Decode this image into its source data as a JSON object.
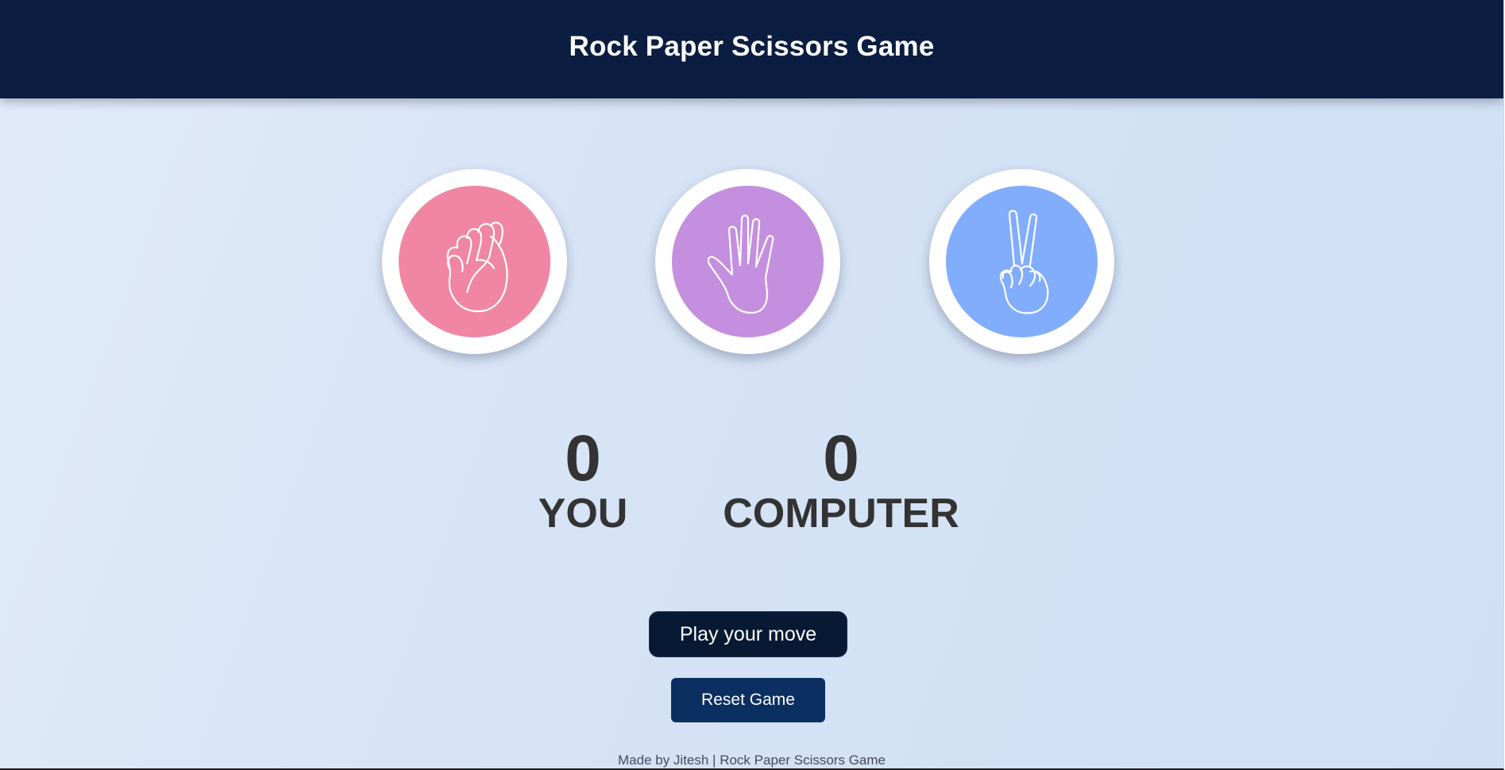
{
  "header": {
    "title": "Rock Paper Scissors Game"
  },
  "choices": [
    {
      "id": "rock",
      "icon": "fist-icon",
      "color": "#f086a4"
    },
    {
      "id": "paper",
      "icon": "open-hand-icon",
      "color": "#c48fdf"
    },
    {
      "id": "scissors",
      "icon": "peace-hand-icon",
      "color": "#82adfc"
    }
  ],
  "scoreboard": {
    "you": {
      "score": "0",
      "label": "YOU"
    },
    "computer": {
      "score": "0",
      "label": "COMPUTER"
    }
  },
  "message": {
    "text": "Play your move"
  },
  "controls": {
    "reset_label": "Reset Game"
  },
  "footer": {
    "text": "Made by Jitesh | Rock Paper Scissors Game"
  },
  "colors": {
    "header_bg": "#0b1d40",
    "message_bg": "#081a33",
    "reset_bg": "#0b2f60",
    "text_dark": "#333333"
  }
}
